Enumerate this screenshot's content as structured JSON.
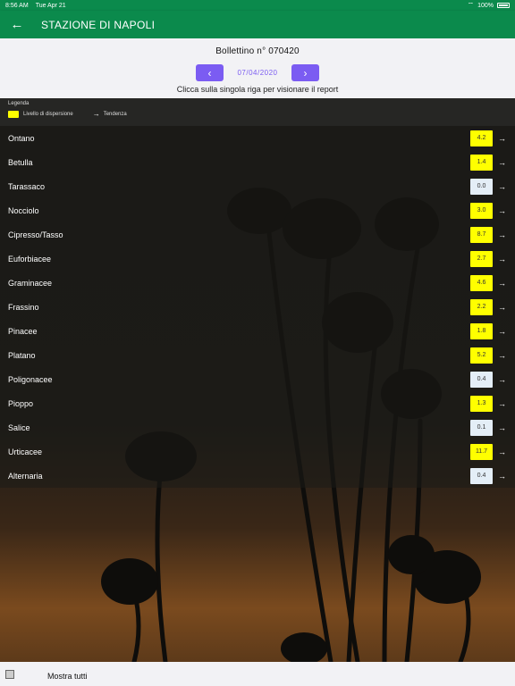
{
  "status_bar": {
    "time": "8:56 AM",
    "date": "Tue Apr 21",
    "battery": "100%"
  },
  "app_bar": {
    "title": "STAZIONE DI NAPOLI"
  },
  "header": {
    "bulletin": "Bollettino n° 070420",
    "date": "07/04/2020",
    "hint": "Clicca sulla singola riga per visionare il report"
  },
  "legend": {
    "title": "Legenda",
    "dispersion_label": "Livello di dispersione",
    "trend_label": "Tendenza",
    "highlight_color": "#ffff00"
  },
  "pollens": [
    {
      "name": "Ontano",
      "value": "4.2",
      "level": "high"
    },
    {
      "name": "Betulla",
      "value": "1.4",
      "level": "high"
    },
    {
      "name": "Tarassaco",
      "value": "0.0",
      "level": "low"
    },
    {
      "name": "Nocciolo",
      "value": "3.0",
      "level": "high"
    },
    {
      "name": "Cipresso/Tasso",
      "value": "8.7",
      "level": "high"
    },
    {
      "name": "Euforbiacee",
      "value": "2.7",
      "level": "high"
    },
    {
      "name": "Graminacee",
      "value": "4.6",
      "level": "high"
    },
    {
      "name": "Frassino",
      "value": "2.2",
      "level": "high"
    },
    {
      "name": "Pinacee",
      "value": "1.8",
      "level": "high"
    },
    {
      "name": "Platano",
      "value": "5.2",
      "level": "high"
    },
    {
      "name": "Poligonacee",
      "value": "0.4",
      "level": "low"
    },
    {
      "name": "Pioppo",
      "value": "1.3",
      "level": "high"
    },
    {
      "name": "Salice",
      "value": "0.1",
      "level": "low"
    },
    {
      "name": "Urticacee",
      "value": "11.7",
      "level": "high"
    },
    {
      "name": "Alternaria",
      "value": "0.4",
      "level": "low"
    }
  ],
  "footer": {
    "show_all_label": "Mostra tutti"
  },
  "colors": {
    "app_bar": "#0b8a4c",
    "accent": "#7b5cf2",
    "high": "#ffff00",
    "low": "#e4eef7"
  }
}
